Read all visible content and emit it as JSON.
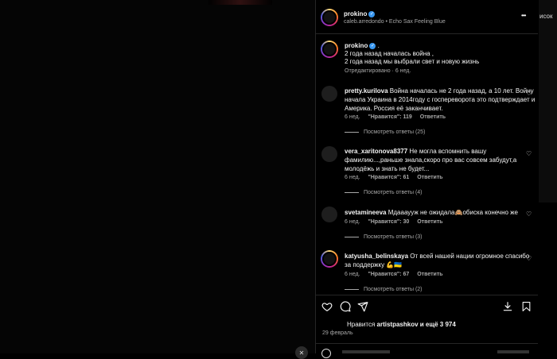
{
  "post": {
    "username": "prokino",
    "subtitle": "caleb.arredondo • Echo Sax Feeling Blue",
    "more_label": "•••",
    "caption_line1": "2 года назад началась война ,",
    "caption_line2": "2 года назад мы выбрали свет и новую жизнь",
    "caption_meta": "Отредактировано · 6 нед.",
    "caption_dot": "."
  },
  "comments": [
    {
      "username": "pretty.kurilova",
      "text": "Война началась не 2 года назад, а 10 лет. Войну начала Украина в 2014году с госпереворота это подтверждает и Америка. Россия её заканчивает.",
      "time": "6 нед.",
      "likes": "\"Нравится\": 119",
      "reply": "Ответить",
      "view_replies": "Посмотреть ответы (25)"
    },
    {
      "username": "vera_xaritonova8377",
      "text": "Не могла вспомнить вашу фамилию...,раньше знала,скоро про вас совсем забудут,а молодёжь и знать не будет...",
      "time": "6 нед.",
      "likes": "\"Нравится\": 61",
      "reply": "Ответить",
      "view_replies": "Посмотреть ответы (4)"
    },
    {
      "username": "svetamineeva",
      "text": "Мдаааууж не ожидала🙈обиска конечно же",
      "time": "6 нед.",
      "likes": "\"Нравится\": 30",
      "reply": "Ответить",
      "view_replies": "Посмотреть ответы (3)"
    },
    {
      "username": "katyusha_belinskaya",
      "text": "От всей нашей нации огромное спасибо за поддержку 💪🇺🇦",
      "time": "6 нед.",
      "likes": "\"Нравится\": 67",
      "reply": "Ответить",
      "view_replies": "Посмотреть ответы (2)"
    }
  ],
  "footer": {
    "likes_prefix": "Нравится ",
    "likes_user": "artistpashkov",
    "likes_suffix": " и ещё 3 974",
    "date": "29 февраль"
  },
  "right_strip_text": "исок",
  "icons": {
    "like": "heart-icon",
    "comment": "comment-icon",
    "share": "share-icon",
    "download": "download-icon",
    "save": "bookmark-icon"
  }
}
